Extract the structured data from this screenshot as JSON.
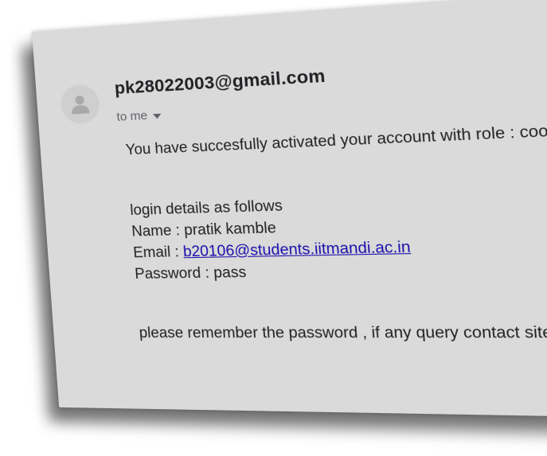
{
  "email": {
    "sender": "pk28022003@gmail.com",
    "recipient_label": "to me",
    "body": {
      "line1": "You have succesfully activated your account with role : coordinator",
      "line2": "login details as follows",
      "name_line": "Name : pratik kamble",
      "email_label": "Email : ",
      "email_link": "b20106@students.iitmandi.ac.in",
      "password_line": "Password : pass",
      "footer_line": "please remember the password , if any query contact site owners"
    }
  }
}
